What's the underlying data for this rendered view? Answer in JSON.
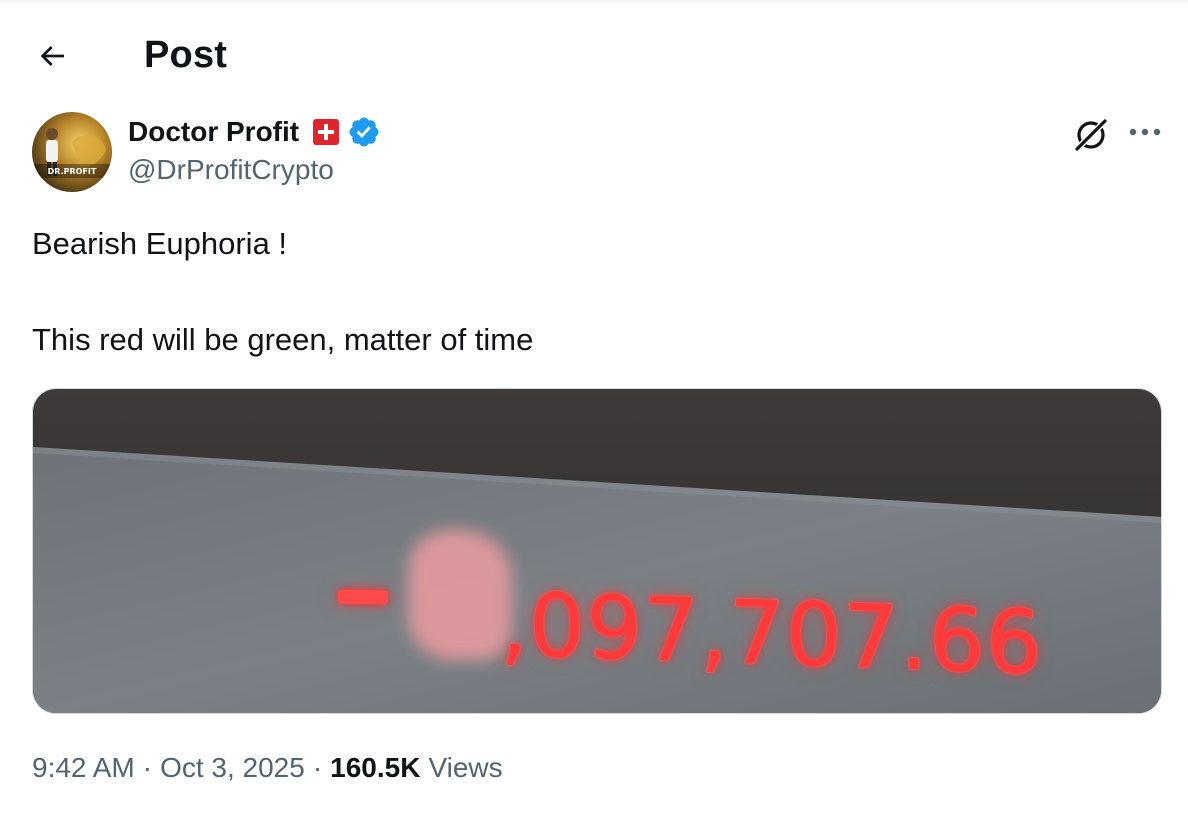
{
  "header": {
    "title": "Post"
  },
  "author": {
    "name": "Doctor Profit",
    "handle": "@DrProfitCrypto",
    "avatar_text": "DR.PROFIT",
    "verified_color": "#1d9bf0",
    "flag_color": "#e0242c"
  },
  "tweet": {
    "lines": [
      "Bearish Euphoria !",
      "This red will be green, matter of time"
    ],
    "media": {
      "amount_visible": ",097,707.66",
      "amount_prefix": "-",
      "amount_color": "#ff3a3a"
    }
  },
  "meta": {
    "time": "9:42 AM",
    "date": "Oct 3, 2025",
    "separator": "·",
    "views_count": "160.5K",
    "views_label": "Views"
  },
  "icons": {
    "back": "arrow-left-icon",
    "grok": "grok-icon",
    "more": "more-horizontal-icon",
    "verified": "verified-badge-icon",
    "flag": "swiss-flag-icon"
  }
}
